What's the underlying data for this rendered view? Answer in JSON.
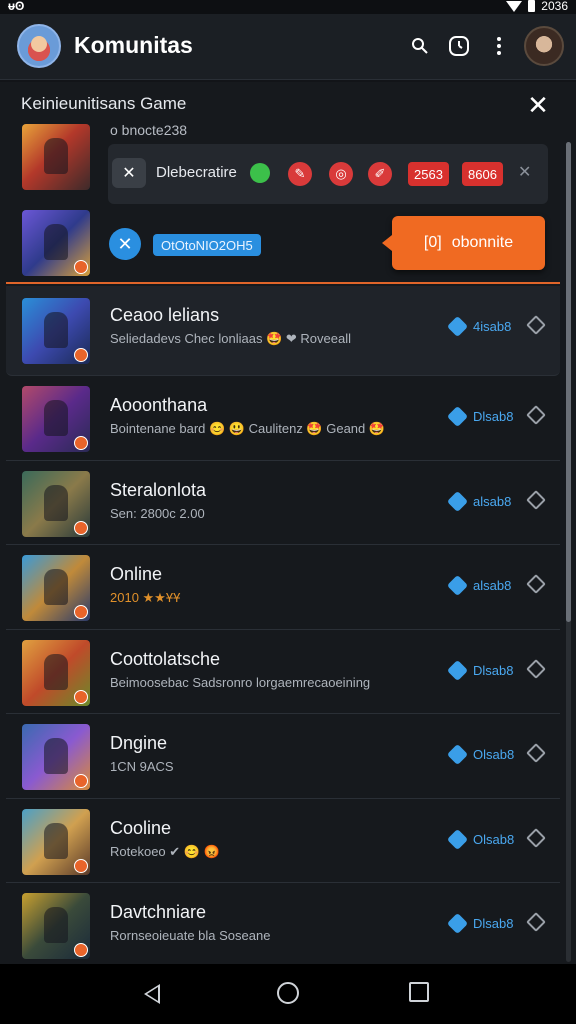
{
  "status_bar": {
    "left": "ᵾʘ",
    "time": "2036"
  },
  "app_bar": {
    "title": "Komunitas"
  },
  "panel": {
    "title": "Keinieunitisans Game",
    "featured_meta": "o  bnocte238",
    "toolbar": {
      "label": "Dlebecratire",
      "pill_1": "2563",
      "pill_2": "8606"
    },
    "chip": "OtOtoNIO2OH5",
    "cta_label": "obonnite",
    "cta_icon": "[0]"
  },
  "list": [
    {
      "title": "Ceaoo lelians",
      "subtitle": "Seliedadevs Chec lonliaas 🤩 ❤ Roveeall",
      "stat": "4isab8"
    },
    {
      "title": "Aooonthana",
      "subtitle": "Bointenane bard 😊 😃 Caulitenz 🤩 Geand 🤩",
      "stat": "Dlsab8"
    },
    {
      "title": "Steralonlota",
      "subtitle": "Sen: 2800c 2.00",
      "stat": "alsab8"
    },
    {
      "title": "Online",
      "subtitle": "2010 ★★ҰҰ",
      "stat": "alsab8"
    },
    {
      "title": "Coottolatsche",
      "subtitle": "Beimoosebac Sadsronro lorgaemrecaoeining",
      "stat": "Dlsab8"
    },
    {
      "title": "Dngine",
      "subtitle": "1CN 9ACS",
      "stat": "Olsab8"
    },
    {
      "title": "Cooline",
      "subtitle": "Rotekoeo ✔ 😊 😡",
      "stat": "Olsab8"
    },
    {
      "title": "Davtchniare",
      "subtitle": "Rornseoieuate bla Soseane",
      "stat": "Dlsab8"
    }
  ],
  "colors": {
    "accent": "#f06a22",
    "link": "#3a9ee8",
    "danger": "#d8312e"
  }
}
